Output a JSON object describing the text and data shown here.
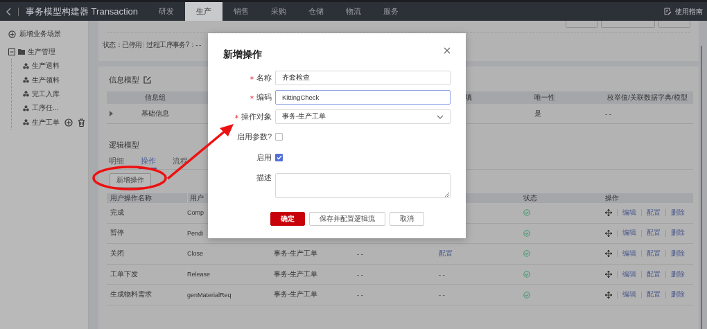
{
  "header": {
    "title": "事务模型构建器 Transaction",
    "tabs": [
      {
        "label": "研发",
        "selected": false
      },
      {
        "label": "生产",
        "selected": true
      },
      {
        "label": "销售",
        "selected": false
      },
      {
        "label": "采购",
        "selected": false
      },
      {
        "label": "仓储",
        "selected": false
      },
      {
        "label": "物流",
        "selected": false
      },
      {
        "label": "服务",
        "selected": false
      }
    ],
    "guide": "使用指南"
  },
  "sidebar": {
    "add_label": "新增业务场景",
    "tree": [
      {
        "label": "生产管理",
        "expanded": true,
        "children": [
          {
            "label": "生产退料",
            "hovered": false
          },
          {
            "label": "生产领料",
            "hovered": false
          },
          {
            "label": "完工入库",
            "hovered": false
          },
          {
            "label": "工序任...",
            "hovered": false
          },
          {
            "label": "生产工单",
            "hovered": true
          }
        ]
      }
    ]
  },
  "status_card": {
    "fields": [
      "状态：已停用",
      "过程工序事务?：- -"
    ]
  },
  "info_model": {
    "title": "信息模型",
    "columns": [
      {
        "label": "信息组"
      },
      {
        "label": "填"
      },
      {
        "label": "唯一性"
      },
      {
        "label": "枚举值/关联数据字典/模型"
      }
    ],
    "rows": [
      {
        "group": "基础信息",
        "unique": "是",
        "enum": "- -"
      }
    ]
  },
  "logic_model": {
    "title": "逻辑模型",
    "tabs": [
      {
        "label": "明细",
        "selected": false
      },
      {
        "label": "操作",
        "selected": true
      },
      {
        "label": "流程",
        "selected": false
      }
    ],
    "add_button": "新增操作",
    "columns": [
      {
        "label": "用户操作名称"
      },
      {
        "label": "用户"
      },
      {
        "label": "状态"
      },
      {
        "label": "操作"
      }
    ],
    "rows": [
      {
        "name": "完成",
        "code": "Comp",
        "enabled": true,
        "actions": [
          "编辑",
          "配置",
          "删除"
        ]
      },
      {
        "name": "暂停",
        "code": "Pendi",
        "enabled": true,
        "actions": [
          "编辑",
          "配置",
          "删除"
        ]
      },
      {
        "name": "关闭",
        "code": "Close",
        "object": "事务-生产工单",
        "column_4": "- -",
        "column_5": {
          "text": "配置",
          "kind": "link"
        },
        "enabled": true,
        "actions": [
          "编辑",
          "配置",
          "删除"
        ]
      },
      {
        "name": "工单下发",
        "code": "Release",
        "object": "事务-生产工单",
        "column_4": "- -",
        "column_5": {
          "text": "- -",
          "kind": "text"
        },
        "enabled": true,
        "actions": [
          "编辑",
          "配置",
          "删除"
        ]
      },
      {
        "name": "生成物料需求",
        "code": "genMaterialReq",
        "object": "事务-生产工单",
        "column_4": "- -",
        "column_5": {
          "text": "- -",
          "kind": "text"
        },
        "enabled": true,
        "actions": [
          "编辑",
          "配置",
          "删除"
        ]
      }
    ]
  },
  "dialog": {
    "title": "新增操作",
    "fields": [
      {
        "kind": "input",
        "label": "名称",
        "required": true,
        "value": "齐套检查",
        "focused": false
      },
      {
        "kind": "input",
        "label": "编码",
        "required": true,
        "value": "KittingCheck",
        "focused": true
      },
      {
        "kind": "select",
        "label": "操作对象",
        "required": true,
        "value": "事务-生产工单"
      },
      {
        "kind": "checkbox",
        "label": "启用参数?",
        "checked": false
      },
      {
        "kind": "checkbox",
        "label": "启用",
        "checked": true
      },
      {
        "kind": "textarea",
        "label": "描述"
      }
    ],
    "buttons": [
      {
        "label": "确定",
        "primary": true
      },
      {
        "label": "保存并配置逻辑流",
        "primary": false
      },
      {
        "label": "取消",
        "primary": false
      }
    ]
  }
}
